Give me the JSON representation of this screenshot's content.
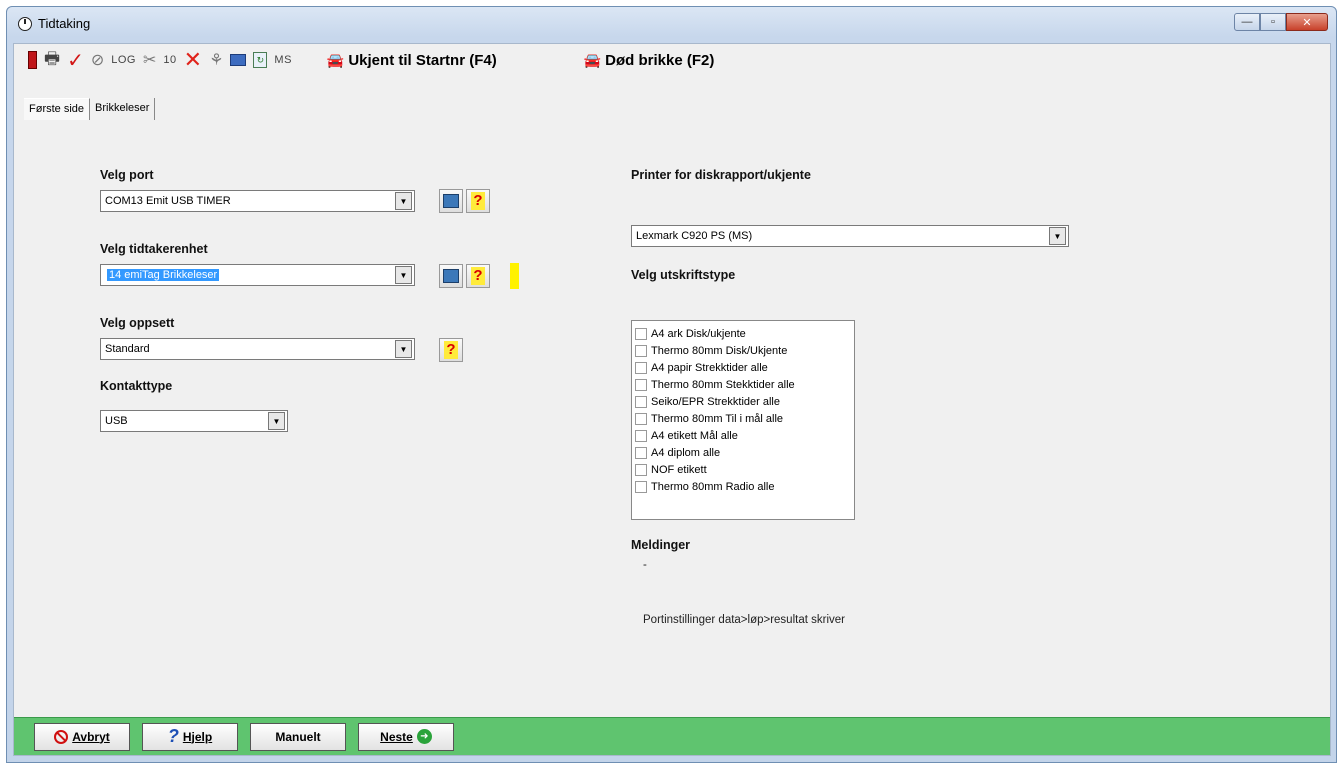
{
  "window": {
    "title": "Tidtaking",
    "minimize": "—",
    "maximize": "▫",
    "close": "✕"
  },
  "toolbar": {
    "log_label": "LOG",
    "ten_label": "10",
    "ms_label": "MS",
    "unknown_startnr": "Ukjent til Startnr (F4)",
    "dead_chip": "Død brikke (F2)"
  },
  "tabs": [
    {
      "label": "Første side"
    },
    {
      "label": "Brikkeleser"
    }
  ],
  "left": {
    "port_label": "Velg port",
    "port_value": "COM13 Emit USB TIMER",
    "unit_label": "Velg tidtakerenhet",
    "unit_value": "14  emiTag Brikkeleser",
    "setup_label": "Velg oppsett",
    "setup_value": "Standard",
    "contact_label": "Kontakttype",
    "contact_value": "USB"
  },
  "right": {
    "printer_label": "Printer for diskrapport/ukjente",
    "printer_value": "Lexmark C920 PS (MS)",
    "print_type_label": "Velg utskriftstype",
    "print_types": [
      {
        "label": "A4 ark Disk/ukjente",
        "checked": false
      },
      {
        "label": "Thermo 80mm Disk/Ukjente",
        "checked": false
      },
      {
        "label": "A4 papir Strekktider alle",
        "checked": false
      },
      {
        "label": "Thermo 80mm Stekktider alle",
        "checked": false
      },
      {
        "label": "Seiko/EPR Strekktider alle",
        "checked": false
      },
      {
        "label": "Thermo 80mm Til i mål alle",
        "checked": false
      },
      {
        "label": "A4 etikett Mål alle",
        "checked": false
      },
      {
        "label": "A4 diplom alle",
        "checked": false
      },
      {
        "label": "NOF etikett",
        "checked": false
      },
      {
        "label": "Thermo 80mm Radio alle",
        "checked": false
      }
    ],
    "messages_label": "Meldinger",
    "messages_value": "-",
    "port_settings_text": "Portinstillinger data>løp>resultat skriver"
  },
  "bottom": {
    "cancel": "Avbryt",
    "help": "Hjelp",
    "manual": "Manuelt",
    "next": "Neste"
  },
  "colors": {
    "bottom_bar": "#5fc46f",
    "selection": "#3399ff",
    "help_yellow": "#fff200"
  }
}
